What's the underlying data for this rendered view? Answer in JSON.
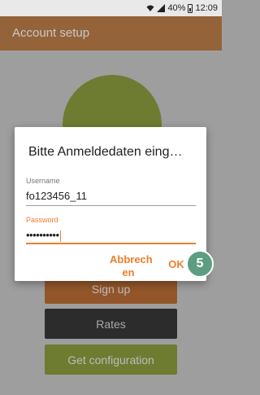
{
  "status_bar": {
    "battery": "40%",
    "time": "12:09"
  },
  "app_bar": {
    "title": "Account setup"
  },
  "buttons": {
    "sign_up": "Sign up",
    "rates": "Rates",
    "get_configuration": "Get configuration"
  },
  "dialog": {
    "title": "Bitte Anmeldedaten eing…",
    "username_label": "Username",
    "username_value": "fo123456_11",
    "password_label": "Password",
    "password_value": "••••••••••",
    "cancel_label_line1": "Abbrech",
    "cancel_label_line2": "en",
    "ok_label": "OK"
  },
  "step_badge": "5",
  "colors": {
    "accent": "#ef7d2c",
    "logo_green": "#6d7c31",
    "badge": "#5d9e82"
  }
}
